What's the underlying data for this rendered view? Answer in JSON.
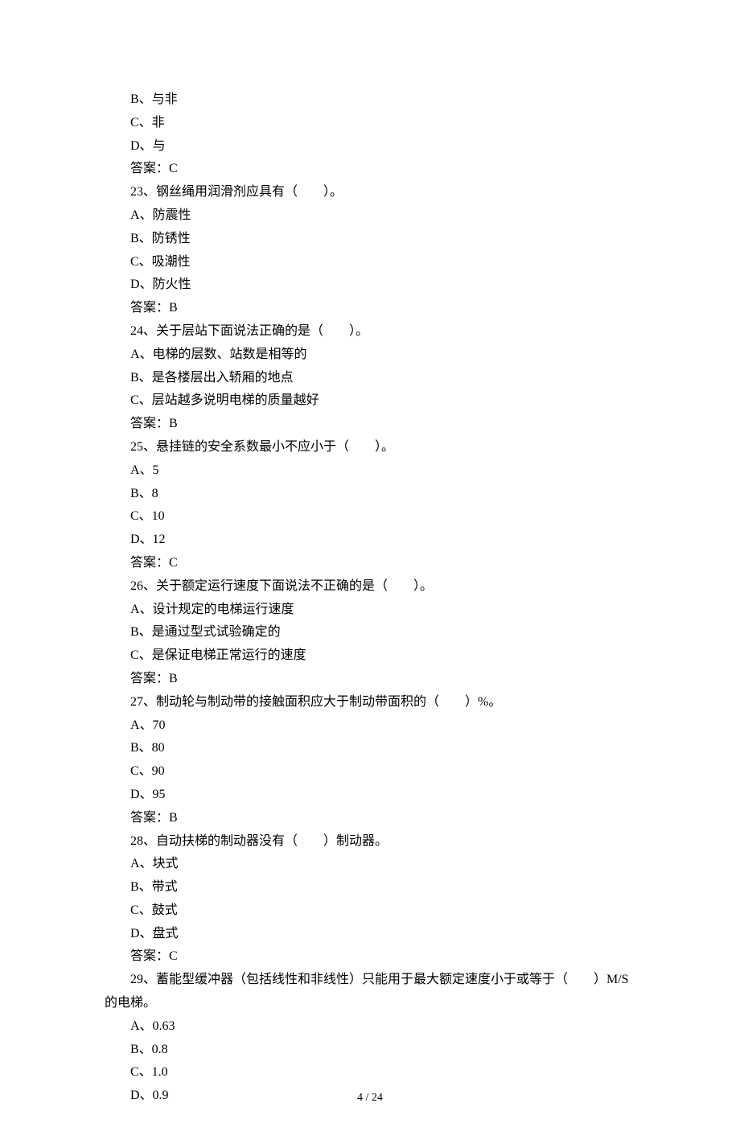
{
  "lines": [
    "B、与非",
    "C、非",
    "D、与",
    "答案：C",
    "23、钢丝绳用润滑剂应具有（　　）。",
    "A、防震性",
    "B、防锈性",
    "C、吸潮性",
    "D、防火性",
    "答案：B",
    "24、关于层站下面说法正确的是（　　）。",
    "A、电梯的层数、站数是相等的",
    "B、是各楼层出入轿厢的地点",
    "C、层站越多说明电梯的质量越好",
    "答案：B",
    "25、悬挂链的安全系数最小不应小于（　　）。",
    "A、5",
    "B、8",
    "C、10",
    "D、12",
    "答案：C",
    "26、关于额定运行速度下面说法不正确的是（　　）。",
    "A、设计规定的电梯运行速度",
    "B、是通过型式试验确定的",
    "C、是保证电梯正常运行的速度",
    "答案：B",
    "27、制动轮与制动带的接触面积应大于制动带面积的（　　）%。",
    "A、70",
    "B、80",
    "C、90",
    "D、95",
    "答案：B",
    "28、自动扶梯的制动器没有（　　）制动器。",
    "A、块式",
    "B、带式",
    "C、鼓式",
    "D、盘式",
    "答案：C"
  ],
  "q29_part1": "29、蓄能型缓冲器（包括线性和非线性）只能用于最大额定速度小于或等于（　　）M/S",
  "q29_part2": "的电梯。",
  "q29_options": [
    "A、0.63",
    "B、0.8",
    "C、1.0",
    "D、0.9"
  ],
  "footer": "4  /  24"
}
